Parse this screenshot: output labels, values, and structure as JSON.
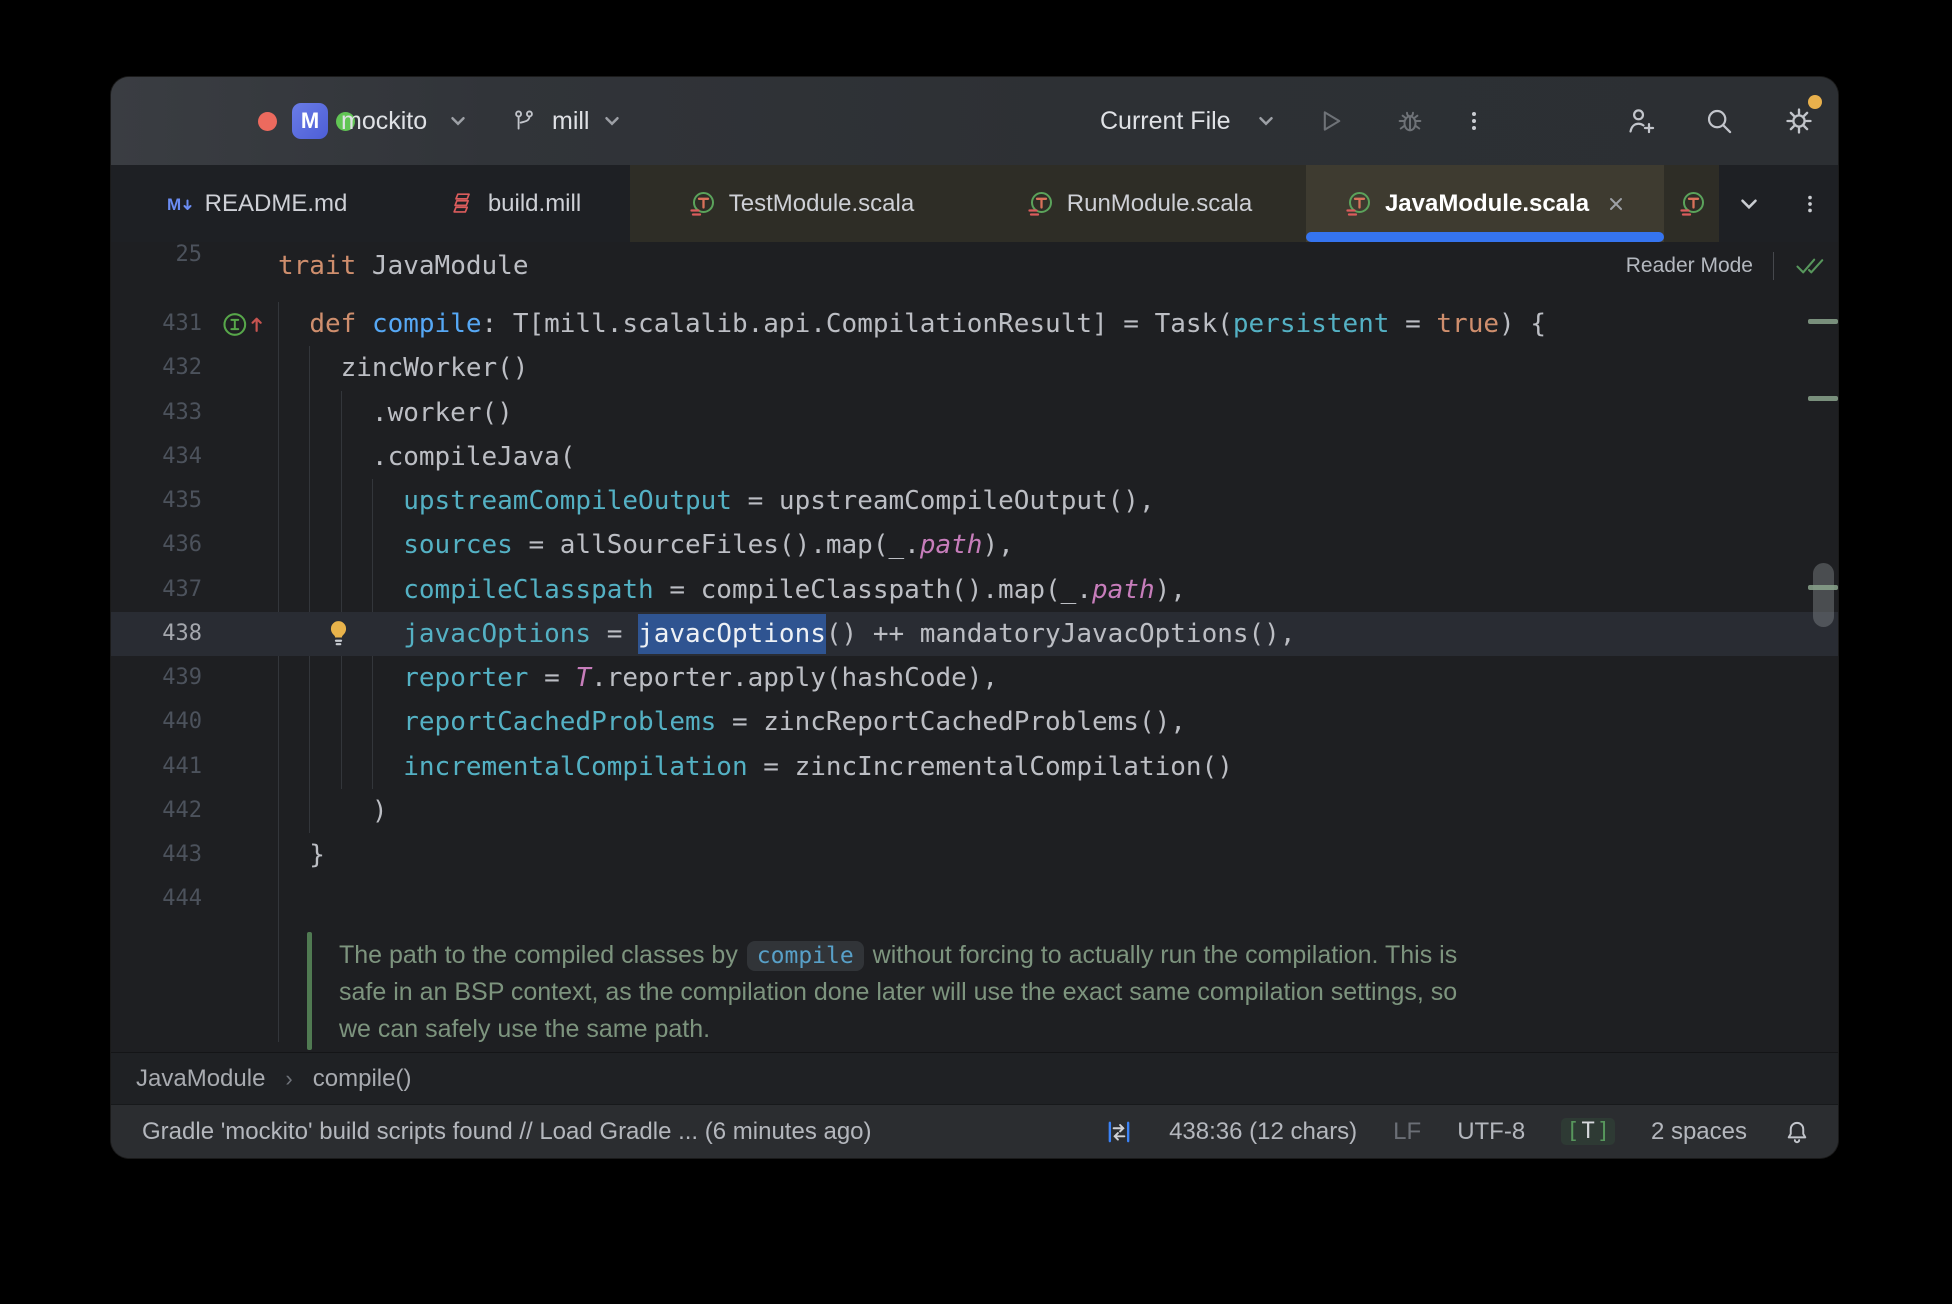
{
  "titlebar": {
    "project_badge": "M",
    "project_name": "mockito",
    "vcs_branch": "mill",
    "run_config": "Current File"
  },
  "tabs": {
    "items": [
      {
        "label": "README.md",
        "icon": "markdown-icon",
        "state": "inactive"
      },
      {
        "label": "build.mill",
        "icon": "mill-file-icon",
        "state": "inactive"
      },
      {
        "label": "TestModule.scala",
        "icon": "scala-trait-icon",
        "state": "highlighted"
      },
      {
        "label": "RunModule.scala",
        "icon": "scala-trait-icon",
        "state": "highlighted"
      },
      {
        "label": "JavaModule.scala",
        "icon": "scala-trait-icon",
        "state": "active",
        "closable": true
      },
      {
        "label": "",
        "icon": "scala-trait-icon",
        "state": "highlighted-clipped"
      }
    ]
  },
  "sticky_header": {
    "line_number": "25",
    "segments": [
      {
        "t": "trait",
        "c": "kw"
      },
      {
        "t": " JavaModule",
        "c": "pl"
      }
    ],
    "reader_mode_label": "Reader Mode"
  },
  "editor": {
    "lines": [
      {
        "n": "431",
        "gutter": "override-up-icon",
        "segs": [
          {
            "t": "  ",
            "c": "pl"
          },
          {
            "t": "def",
            "c": "kw"
          },
          {
            "t": " ",
            "c": "pl"
          },
          {
            "t": "compile",
            "c": "fn"
          },
          {
            "t": ": T[mill.scalalib.api.CompilationResult] = Task(",
            "c": "pl"
          },
          {
            "t": "persistent",
            "c": "arg"
          },
          {
            "t": " = ",
            "c": "pl"
          },
          {
            "t": "true",
            "c": "kw"
          },
          {
            "t": ") {",
            "c": "pl"
          }
        ]
      },
      {
        "n": "432",
        "segs": [
          {
            "t": "    zincWorker()",
            "c": "pl"
          }
        ]
      },
      {
        "n": "433",
        "segs": [
          {
            "t": "      .worker()",
            "c": "pl"
          }
        ]
      },
      {
        "n": "434",
        "segs": [
          {
            "t": "      .compileJava(",
            "c": "pl"
          }
        ]
      },
      {
        "n": "435",
        "segs": [
          {
            "t": "        ",
            "c": "pl"
          },
          {
            "t": "upstreamCompileOutput",
            "c": "arg"
          },
          {
            "t": " = upstreamCompileOutput(),",
            "c": "pl"
          }
        ]
      },
      {
        "n": "436",
        "segs": [
          {
            "t": "        ",
            "c": "pl"
          },
          {
            "t": "sources",
            "c": "arg"
          },
          {
            "t": " = allSourceFiles().map(_.",
            "c": "pl"
          },
          {
            "t": "path",
            "c": "ty"
          },
          {
            "t": "),",
            "c": "pl"
          }
        ]
      },
      {
        "n": "437",
        "segs": [
          {
            "t": "        ",
            "c": "pl"
          },
          {
            "t": "compileClasspath",
            "c": "arg"
          },
          {
            "t": " = compileClasspath().map(_.",
            "c": "pl"
          },
          {
            "t": "path",
            "c": "ty"
          },
          {
            "t": "),",
            "c": "pl"
          }
        ]
      },
      {
        "n": "438",
        "current": true,
        "gutter": "lightbulb-icon",
        "segs": [
          {
            "t": "        ",
            "c": "pl"
          },
          {
            "t": "javacOptions",
            "c": "arg"
          },
          {
            "t": " = ",
            "c": "pl"
          },
          {
            "t": "javacOptions",
            "c": "sel"
          },
          {
            "t": "() ++ mandatoryJavacOptions(),",
            "c": "pl"
          }
        ]
      },
      {
        "n": "439",
        "segs": [
          {
            "t": "        ",
            "c": "pl"
          },
          {
            "t": "reporter",
            "c": "arg"
          },
          {
            "t": " = ",
            "c": "pl"
          },
          {
            "t": "T",
            "c": "ty"
          },
          {
            "t": ".reporter.apply(hashCode),",
            "c": "pl"
          }
        ]
      },
      {
        "n": "440",
        "segs": [
          {
            "t": "        ",
            "c": "pl"
          },
          {
            "t": "reportCachedProblems",
            "c": "arg"
          },
          {
            "t": " = zincReportCachedProblems(),",
            "c": "pl"
          }
        ]
      },
      {
        "n": "441",
        "segs": [
          {
            "t": "        ",
            "c": "pl"
          },
          {
            "t": "incrementalCompilation",
            "c": "arg"
          },
          {
            "t": " = zincIncrementalCompilation()",
            "c": "pl"
          }
        ]
      },
      {
        "n": "442",
        "segs": [
          {
            "t": "      )",
            "c": "pl"
          }
        ]
      },
      {
        "n": "443",
        "segs": [
          {
            "t": "  }",
            "c": "pl"
          }
        ]
      },
      {
        "n": "444",
        "segs": []
      }
    ],
    "doc_comment": {
      "lines": [
        {
          "pre": "The path to the compiled classes by ",
          "code": "compile",
          "post": " without forcing to actually run the compilation. This is"
        },
        {
          "pre": "safe in an BSP context, as the compilation done later will use the exact same compilation settings, so"
        },
        {
          "pre": "we can safely use the same path."
        }
      ]
    }
  },
  "breadcrumbs": {
    "items": [
      "JavaModule",
      "compile()"
    ]
  },
  "status_bar": {
    "message": "Gradle 'mockito' build scripts found // Load Gradle ... (6 minutes ago)",
    "caret_position": "438:36 (12 chars)",
    "line_separator": "LF",
    "encoding": "UTF-8",
    "tab_size_indicator": "T",
    "indent_info": "2 spaces"
  },
  "colors": {
    "accent": "#3574F0",
    "keyword": "#CF8E6D",
    "function_decl": "#56A8F5",
    "named_argument": "#54B1C4",
    "type_param_italic": "#C77DBB",
    "plain_code": "#BCBEC4",
    "selection": "#2F5491",
    "doc_comment": "#7D947E",
    "editor_bg": "#1E1F22",
    "window_bg": "#2B2D30",
    "tab_highlight_bg": "#2E2D26",
    "gear_badge": "#E8B04C",
    "traffic_lights": [
      "#EC6A5E",
      "#F4BF4F",
      "#61C554"
    ]
  }
}
